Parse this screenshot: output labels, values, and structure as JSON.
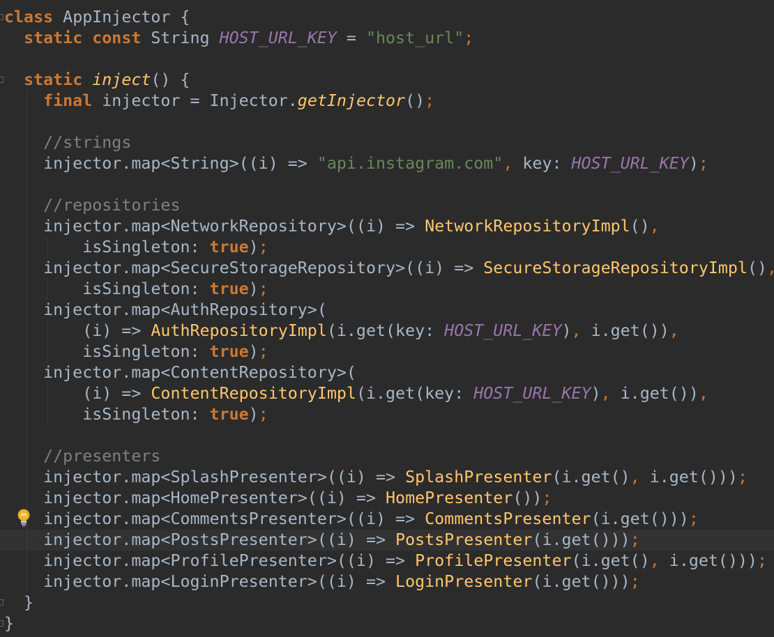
{
  "colors": {
    "background": "#2b2b2b",
    "current_line": "#323232",
    "keyword": "#cc7832",
    "plain": "#a9b7c6",
    "constant": "#9876aa",
    "string": "#6a8759",
    "comment": "#808080",
    "function": "#ffc66d"
  },
  "editor": {
    "language": "dart",
    "current_line_index": 25,
    "intention_icon": "lightbulb-icon",
    "lines": [
      [
        [
          "keyword",
          "class"
        ],
        [
          "plain",
          " AppInjector {"
        ]
      ],
      [
        [
          "plain",
          "  "
        ],
        [
          "keyword",
          "static const"
        ],
        [
          "plain",
          " String "
        ],
        [
          "const",
          "HOST_URL_KEY"
        ],
        [
          "plain",
          " = "
        ],
        [
          "string",
          "\"host_url\""
        ],
        [
          "punct",
          ";"
        ]
      ],
      [],
      [
        [
          "plain",
          "  "
        ],
        [
          "keyword",
          "static"
        ],
        [
          "plain",
          " "
        ],
        [
          "fnital",
          "inject"
        ],
        [
          "plain",
          "() {"
        ]
      ],
      [
        [
          "plain",
          "    "
        ],
        [
          "keyword",
          "final"
        ],
        [
          "plain",
          " injector = Injector."
        ],
        [
          "fnital",
          "getInjector"
        ],
        [
          "plain",
          "()"
        ],
        [
          "punct",
          ";"
        ]
      ],
      [],
      [
        [
          "plain",
          "    "
        ],
        [
          "comment",
          "//strings"
        ]
      ],
      [
        [
          "plain",
          "    injector.map<String>((i) => "
        ],
        [
          "string",
          "\"api.instagram.com\""
        ],
        [
          "punct",
          ","
        ],
        [
          "plain",
          " key: "
        ],
        [
          "const",
          "HOST_URL_KEY"
        ],
        [
          "plain",
          ")"
        ],
        [
          "punct",
          ";"
        ]
      ],
      [],
      [
        [
          "plain",
          "    "
        ],
        [
          "comment",
          "//repositories"
        ]
      ],
      [
        [
          "plain",
          "    injector.map<NetworkRepository>((i) => "
        ],
        [
          "fn",
          "NetworkRepositoryImpl"
        ],
        [
          "plain",
          "()"
        ],
        [
          "punct",
          ","
        ]
      ],
      [
        [
          "plain",
          "        isSingleton: "
        ],
        [
          "keyword",
          "true"
        ],
        [
          "plain",
          ")"
        ],
        [
          "punct",
          ";"
        ]
      ],
      [
        [
          "plain",
          "    injector.map<SecureStorageRepository>((i) => "
        ],
        [
          "fn",
          "SecureStorageRepositoryImpl"
        ],
        [
          "plain",
          "()"
        ],
        [
          "punct",
          ","
        ]
      ],
      [
        [
          "plain",
          "        isSingleton: "
        ],
        [
          "keyword",
          "true"
        ],
        [
          "plain",
          ")"
        ],
        [
          "punct",
          ";"
        ]
      ],
      [
        [
          "plain",
          "    injector.map<AuthRepository>("
        ]
      ],
      [
        [
          "plain",
          "        (i) => "
        ],
        [
          "fn",
          "AuthRepositoryImpl"
        ],
        [
          "plain",
          "(i.get(key: "
        ],
        [
          "const",
          "HOST_URL_KEY"
        ],
        [
          "plain",
          ")"
        ],
        [
          "punct",
          ","
        ],
        [
          "plain",
          " i.get())"
        ],
        [
          "punct",
          ","
        ]
      ],
      [
        [
          "plain",
          "        isSingleton: "
        ],
        [
          "keyword",
          "true"
        ],
        [
          "plain",
          ")"
        ],
        [
          "punct",
          ";"
        ]
      ],
      [
        [
          "plain",
          "    injector.map<ContentRepository>("
        ]
      ],
      [
        [
          "plain",
          "        (i) => "
        ],
        [
          "fn",
          "ContentRepositoryImpl"
        ],
        [
          "plain",
          "(i.get(key: "
        ],
        [
          "const",
          "HOST_URL_KEY"
        ],
        [
          "plain",
          ")"
        ],
        [
          "punct",
          ","
        ],
        [
          "plain",
          " i.get())"
        ],
        [
          "punct",
          ","
        ]
      ],
      [
        [
          "plain",
          "        isSingleton: "
        ],
        [
          "keyword",
          "true"
        ],
        [
          "plain",
          ")"
        ],
        [
          "punct",
          ";"
        ]
      ],
      [],
      [
        [
          "plain",
          "    "
        ],
        [
          "comment",
          "//presenters"
        ]
      ],
      [
        [
          "plain",
          "    injector.map<SplashPresenter>((i) => "
        ],
        [
          "fn",
          "SplashPresenter"
        ],
        [
          "plain",
          "(i.get()"
        ],
        [
          "punct",
          ","
        ],
        [
          "plain",
          " i.get()))"
        ],
        [
          "punct",
          ";"
        ]
      ],
      [
        [
          "plain",
          "    injector.map<HomePresenter>((i) => "
        ],
        [
          "fn",
          "HomePresenter"
        ],
        [
          "plain",
          "())"
        ],
        [
          "punct",
          ";"
        ]
      ],
      [
        [
          "plain",
          "    injector.map<CommentsPresenter>((i) => "
        ],
        [
          "fn",
          "CommentsPresenter"
        ],
        [
          "plain",
          "(i.get()))"
        ],
        [
          "punct",
          ";"
        ]
      ],
      [
        [
          "plain",
          "    injector.map<PostsPresenter>((i) => "
        ],
        [
          "fn",
          "PostsPresenter"
        ],
        [
          "plain",
          "(i.get()))"
        ],
        [
          "punct",
          ";"
        ]
      ],
      [
        [
          "plain",
          "    injector.map<ProfilePresenter>((i) => "
        ],
        [
          "fn",
          "ProfilePresenter"
        ],
        [
          "plain",
          "(i.get()"
        ],
        [
          "punct",
          ","
        ],
        [
          "plain",
          " i.get()))"
        ],
        [
          "punct",
          ";"
        ]
      ],
      [
        [
          "plain",
          "    injector.map<LoginPresenter>((i) => "
        ],
        [
          "fn",
          "LoginPresenter"
        ],
        [
          "plain",
          "(i.get()))"
        ],
        [
          "punct",
          ";"
        ]
      ],
      [
        [
          "plain",
          "  }"
        ]
      ],
      [
        [
          "plain",
          "}"
        ]
      ]
    ]
  }
}
